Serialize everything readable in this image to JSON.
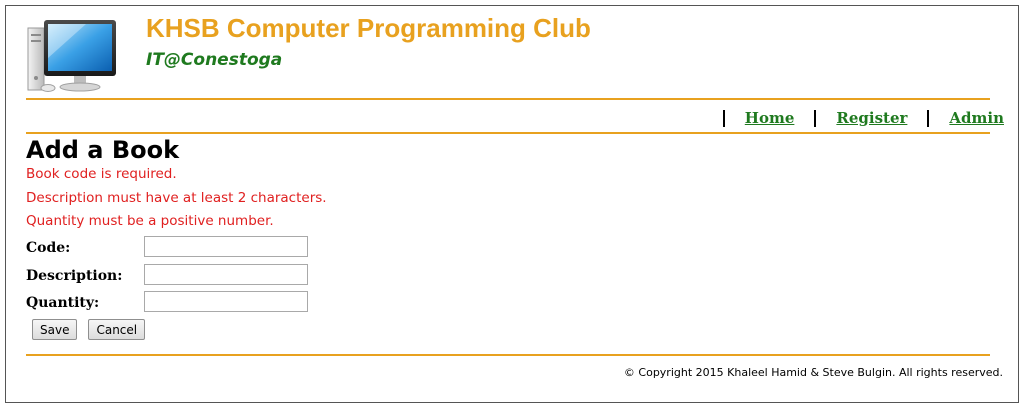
{
  "header": {
    "title": "KHSB Computer Programming Club",
    "subtitle": "IT@Conestoga",
    "logo_icon": "computer-monitor-icon"
  },
  "nav": {
    "items": [
      {
        "label": "Home"
      },
      {
        "label": "Register"
      },
      {
        "label": "Admin"
      }
    ]
  },
  "page": {
    "title": "Add a Book",
    "errors": [
      "Book code is required.",
      "Description must have at least 2 characters.",
      "Quantity must be a positive number."
    ]
  },
  "form": {
    "fields": [
      {
        "label": "Code:",
        "value": ""
      },
      {
        "label": "Description:",
        "value": ""
      },
      {
        "label": "Quantity:",
        "value": ""
      }
    ],
    "save_label": "Save",
    "cancel_label": "Cancel"
  },
  "footer": {
    "copyright": "© Copyright 2015 Khaleel Hamid & Steve Bulgin. All rights reserved."
  },
  "colors": {
    "brand_orange": "#e8a11f",
    "brand_green": "#1f7a1f",
    "error_red": "#e02020"
  }
}
